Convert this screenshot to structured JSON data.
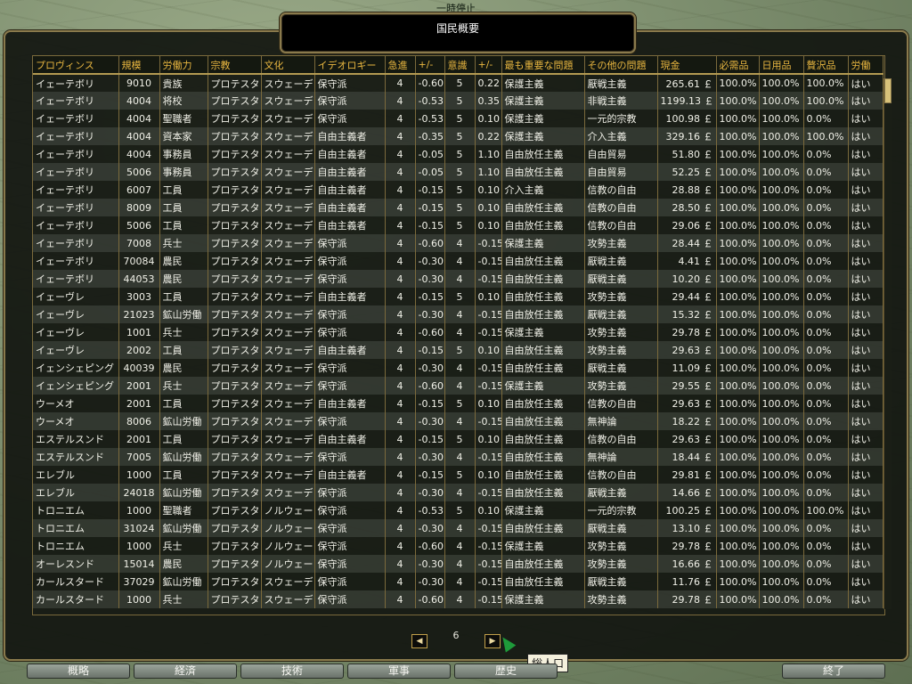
{
  "status": {
    "paused": "一時停止"
  },
  "window": {
    "title": "国民概要"
  },
  "table": {
    "headers": [
      "プロヴィンス",
      "規模",
      "労働力",
      "宗教",
      "文化",
      "イデオロギー",
      "急進",
      "+/-",
      "意識",
      "+/-",
      "最も重要な問題",
      "その他の問題",
      "現金",
      "必需品",
      "日用品",
      "贅沢品",
      "労働"
    ],
    "rows": [
      [
        "イェーテボリ",
        "9010",
        "貴族",
        "プロテスタ",
        "スウェーデ",
        "保守派",
        "4",
        "-0.60",
        "5",
        "0.22",
        "保護主義",
        "厭戦主義",
        "265.61 ￡",
        "100.0%",
        "100.0%",
        "100.0%",
        "はい"
      ],
      [
        "イェーテボリ",
        "4004",
        "将校",
        "プロテスタ",
        "スウェーデ",
        "保守派",
        "4",
        "-0.53",
        "5",
        "0.35",
        "保護主義",
        "非戦主義",
        "1199.13 ￡",
        "100.0%",
        "100.0%",
        "100.0%",
        "はい"
      ],
      [
        "イェーテボリ",
        "4004",
        "聖職者",
        "プロテスタ",
        "スウェーデ",
        "保守派",
        "4",
        "-0.53",
        "5",
        "0.10",
        "保護主義",
        "一元的宗教",
        "100.98 ￡",
        "100.0%",
        "100.0%",
        "0.0%",
        "はい"
      ],
      [
        "イェーテボリ",
        "4004",
        "資本家",
        "プロテスタ",
        "スウェーデ",
        "自由主義者",
        "4",
        "-0.35",
        "5",
        "0.22",
        "保護主義",
        "介入主義",
        "329.16 ￡",
        "100.0%",
        "100.0%",
        "100.0%",
        "はい"
      ],
      [
        "イェーテボリ",
        "4004",
        "事務員",
        "プロテスタ",
        "スウェーデ",
        "自由主義者",
        "4",
        "-0.05",
        "5",
        "1.10",
        "自由放任主義",
        "自由貿易",
        "51.80 ￡",
        "100.0%",
        "100.0%",
        "0.0%",
        "はい"
      ],
      [
        "イェーテボリ",
        "5006",
        "事務員",
        "プロテスタ",
        "スウェーデ",
        "自由主義者",
        "4",
        "-0.05",
        "5",
        "1.10",
        "自由放任主義",
        "自由貿易",
        "52.25 ￡",
        "100.0%",
        "100.0%",
        "0.0%",
        "はい"
      ],
      [
        "イェーテボリ",
        "6007",
        "工員",
        "プロテスタ",
        "スウェーデ",
        "自由主義者",
        "4",
        "-0.15",
        "5",
        "0.10",
        "介入主義",
        "信教の自由",
        "28.88 ￡",
        "100.0%",
        "100.0%",
        "0.0%",
        "はい"
      ],
      [
        "イェーテボリ",
        "8009",
        "工員",
        "プロテスタ",
        "スウェーデ",
        "自由主義者",
        "4",
        "-0.15",
        "5",
        "0.10",
        "自由放任主義",
        "信教の自由",
        "28.50 ￡",
        "100.0%",
        "100.0%",
        "0.0%",
        "はい"
      ],
      [
        "イェーテボリ",
        "5006",
        "工員",
        "プロテスタ",
        "スウェーデ",
        "自由主義者",
        "4",
        "-0.15",
        "5",
        "0.10",
        "自由放任主義",
        "信教の自由",
        "29.06 ￡",
        "100.0%",
        "100.0%",
        "0.0%",
        "はい"
      ],
      [
        "イェーテボリ",
        "7008",
        "兵士",
        "プロテスタ",
        "スウェーデ",
        "保守派",
        "4",
        "-0.60",
        "4",
        "-0.15",
        "保護主義",
        "攻勢主義",
        "28.44 ￡",
        "100.0%",
        "100.0%",
        "0.0%",
        "はい"
      ],
      [
        "イェーテボリ",
        "70084",
        "農民",
        "プロテスタ",
        "スウェーデ",
        "保守派",
        "4",
        "-0.30",
        "4",
        "-0.15",
        "自由放任主義",
        "厭戦主義",
        "4.41 ￡",
        "100.0%",
        "100.0%",
        "0.0%",
        "はい"
      ],
      [
        "イェーテボリ",
        "44053",
        "農民",
        "プロテスタ",
        "スウェーデ",
        "保守派",
        "4",
        "-0.30",
        "4",
        "-0.15",
        "自由放任主義",
        "厭戦主義",
        "10.20 ￡",
        "100.0%",
        "100.0%",
        "0.0%",
        "はい"
      ],
      [
        "イェーヴレ",
        "3003",
        "工員",
        "プロテスタ",
        "スウェーデ",
        "自由主義者",
        "4",
        "-0.15",
        "5",
        "0.10",
        "自由放任主義",
        "攻勢主義",
        "29.44 ￡",
        "100.0%",
        "100.0%",
        "0.0%",
        "はい"
      ],
      [
        "イェーヴレ",
        "21023",
        "鉱山労働",
        "プロテスタ",
        "スウェーデ",
        "保守派",
        "4",
        "-0.30",
        "4",
        "-0.15",
        "自由放任主義",
        "厭戦主義",
        "15.32 ￡",
        "100.0%",
        "100.0%",
        "0.0%",
        "はい"
      ],
      [
        "イェーヴレ",
        "1001",
        "兵士",
        "プロテスタ",
        "スウェーデ",
        "保守派",
        "4",
        "-0.60",
        "4",
        "-0.15",
        "保護主義",
        "攻勢主義",
        "29.78 ￡",
        "100.0%",
        "100.0%",
        "0.0%",
        "はい"
      ],
      [
        "イェーヴレ",
        "2002",
        "工員",
        "プロテスタ",
        "スウェーデ",
        "自由主義者",
        "4",
        "-0.15",
        "5",
        "0.10",
        "自由放任主義",
        "攻勢主義",
        "29.63 ￡",
        "100.0%",
        "100.0%",
        "0.0%",
        "はい"
      ],
      [
        "イェンシェピング",
        "40039",
        "農民",
        "プロテスタ",
        "スウェーデ",
        "保守派",
        "4",
        "-0.30",
        "4",
        "-0.15",
        "自由放任主義",
        "厭戦主義",
        "11.09 ￡",
        "100.0%",
        "100.0%",
        "0.0%",
        "はい"
      ],
      [
        "イェンシェピング",
        "2001",
        "兵士",
        "プロテスタ",
        "スウェーデ",
        "保守派",
        "4",
        "-0.60",
        "4",
        "-0.15",
        "保護主義",
        "攻勢主義",
        "29.55 ￡",
        "100.0%",
        "100.0%",
        "0.0%",
        "はい"
      ],
      [
        "ウーメオ",
        "2001",
        "工員",
        "プロテスタ",
        "スウェーデ",
        "自由主義者",
        "4",
        "-0.15",
        "5",
        "0.10",
        "自由放任主義",
        "信教の自由",
        "29.63 ￡",
        "100.0%",
        "100.0%",
        "0.0%",
        "はい"
      ],
      [
        "ウーメオ",
        "8006",
        "鉱山労働",
        "プロテスタ",
        "スウェーデ",
        "保守派",
        "4",
        "-0.30",
        "4",
        "-0.15",
        "自由放任主義",
        "無神論",
        "18.22 ￡",
        "100.0%",
        "100.0%",
        "0.0%",
        "はい"
      ],
      [
        "エステルスンド",
        "2001",
        "工員",
        "プロテスタ",
        "スウェーデ",
        "自由主義者",
        "4",
        "-0.15",
        "5",
        "0.10",
        "自由放任主義",
        "信教の自由",
        "29.63 ￡",
        "100.0%",
        "100.0%",
        "0.0%",
        "はい"
      ],
      [
        "エステルスンド",
        "7005",
        "鉱山労働",
        "プロテスタ",
        "スウェーデ",
        "保守派",
        "4",
        "-0.30",
        "4",
        "-0.15",
        "自由放任主義",
        "無神論",
        "18.44 ￡",
        "100.0%",
        "100.0%",
        "0.0%",
        "はい"
      ],
      [
        "エレブル",
        "1000",
        "工員",
        "プロテスタ",
        "スウェーデ",
        "自由主義者",
        "4",
        "-0.15",
        "5",
        "0.10",
        "自由放任主義",
        "信教の自由",
        "29.81 ￡",
        "100.0%",
        "100.0%",
        "0.0%",
        "はい"
      ],
      [
        "エレブル",
        "24018",
        "鉱山労働",
        "プロテスタ",
        "スウェーデ",
        "保守派",
        "4",
        "-0.30",
        "4",
        "-0.15",
        "自由放任主義",
        "厭戦主義",
        "14.66 ￡",
        "100.0%",
        "100.0%",
        "0.0%",
        "はい"
      ],
      [
        "トロニエム",
        "1000",
        "聖職者",
        "プロテスタ",
        "ノルウェー",
        "保守派",
        "4",
        "-0.53",
        "5",
        "0.10",
        "保護主義",
        "一元的宗教",
        "100.25 ￡",
        "100.0%",
        "100.0%",
        "100.0%",
        "はい"
      ],
      [
        "トロニエム",
        "31024",
        "鉱山労働",
        "プロテスタ",
        "ノルウェー",
        "保守派",
        "4",
        "-0.30",
        "4",
        "-0.15",
        "自由放任主義",
        "厭戦主義",
        "13.10 ￡",
        "100.0%",
        "100.0%",
        "0.0%",
        "はい"
      ],
      [
        "トロニエム",
        "1000",
        "兵士",
        "プロテスタ",
        "ノルウェー",
        "保守派",
        "4",
        "-0.60",
        "4",
        "-0.15",
        "保護主義",
        "攻勢主義",
        "29.78 ￡",
        "100.0%",
        "100.0%",
        "0.0%",
        "はい"
      ],
      [
        "オーレスンド",
        "15014",
        "農民",
        "プロテスタ",
        "ノルウェー",
        "保守派",
        "4",
        "-0.30",
        "4",
        "-0.15",
        "自由放任主義",
        "攻勢主義",
        "16.66 ￡",
        "100.0%",
        "100.0%",
        "0.0%",
        "はい"
      ],
      [
        "カールスタード",
        "37029",
        "鉱山労働",
        "プロテスタ",
        "スウェーデ",
        "保守派",
        "4",
        "-0.30",
        "4",
        "-0.15",
        "自由放任主義",
        "厭戦主義",
        "11.76 ￡",
        "100.0%",
        "100.0%",
        "0.0%",
        "はい"
      ],
      [
        "カールスタード",
        "1000",
        "兵士",
        "プロテスタ",
        "スウェーデ",
        "保守派",
        "4",
        "-0.60",
        "4",
        "-0.15",
        "保護主義",
        "攻勢主義",
        "29.78 ￡",
        "100.0%",
        "100.0%",
        "0.0%",
        "はい"
      ]
    ]
  },
  "pager": {
    "page": "6",
    "prev_icon": "◀",
    "next_icon": "▶"
  },
  "tooltip": {
    "text": "総人口"
  },
  "tabs": {
    "overview": "概略",
    "economy": "経済",
    "technology": "技術",
    "military": "軍事",
    "history": "歴史",
    "exit": "終了"
  }
}
